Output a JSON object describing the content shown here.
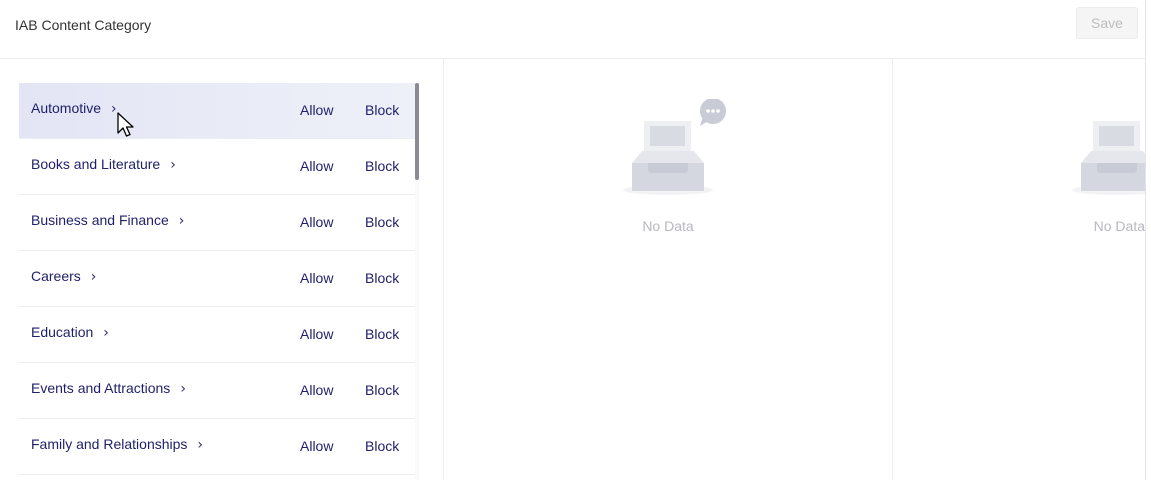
{
  "header": {
    "title": "IAB Content Category",
    "save_label": "Save"
  },
  "categories": [
    {
      "label": "Automotive",
      "allow": "Allow",
      "block": "Block"
    },
    {
      "label": "Books and Literature",
      "allow": "Allow",
      "block": "Block"
    },
    {
      "label": "Business and Finance",
      "allow": "Allow",
      "block": "Block"
    },
    {
      "label": "Careers",
      "allow": "Allow",
      "block": "Block"
    },
    {
      "label": "Education",
      "allow": "Allow",
      "block": "Block"
    },
    {
      "label": "Events and Attractions",
      "allow": "Allow",
      "block": "Block"
    },
    {
      "label": "Family and Relationships",
      "allow": "Allow",
      "block": "Block"
    }
  ],
  "panels": [
    {
      "empty_text": "No Data"
    },
    {
      "empty_text": "No Data"
    }
  ],
  "colors": {
    "accent_text": "#1f1f6b",
    "hover_row": "#e3e5f5",
    "muted": "#b8b8c0"
  },
  "icons": {
    "chevron": "chevron-right-icon",
    "empty": "empty-inbox-icon",
    "cursor": "mouse-pointer-icon"
  }
}
